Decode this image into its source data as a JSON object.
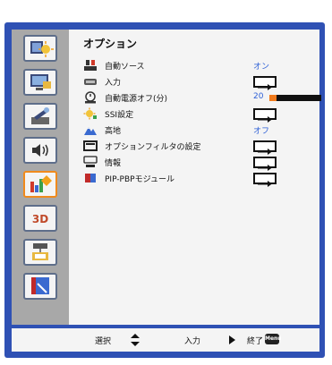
{
  "menu": {
    "title": "オプション",
    "items": [
      {
        "label": "自動ソース",
        "value": "オン",
        "icon": "auto-source-icon"
      },
      {
        "label": "入力",
        "icon": "input-icon"
      },
      {
        "label": "自動電源オフ(分)",
        "value": "20",
        "progress": 0.14,
        "icon": "power-off-timer-icon"
      },
      {
        "label": "SSI設定",
        "icon": "ssi-settings-icon"
      },
      {
        "label": "高地",
        "value": "オフ",
        "icon": "high-altitude-icon"
      },
      {
        "label": "オプションフィルタの設定",
        "icon": "filter-icon"
      },
      {
        "label": "情報",
        "icon": "info-icon"
      },
      {
        "label": "PIP-PBPモジュール",
        "icon": "pip-pbp-icon"
      }
    ]
  },
  "sidebar": {
    "icons": [
      "image-settings-icon",
      "display-icon",
      "setup-icon",
      "volume-icon",
      "options-icon",
      "3d-icon",
      "lan-icon",
      "interactive-icon"
    ],
    "three_d_label": "3D"
  },
  "footer": {
    "select_label": "選択",
    "enter_label": "入力",
    "exit_label": "終了",
    "menu_key": "Menu"
  },
  "colors": {
    "frame": "#2f51b4",
    "sidebar": "#a8a8a8",
    "panel": "#f4f4f4",
    "accent": "#f08a1c",
    "value_text": "#2d5fd6"
  }
}
